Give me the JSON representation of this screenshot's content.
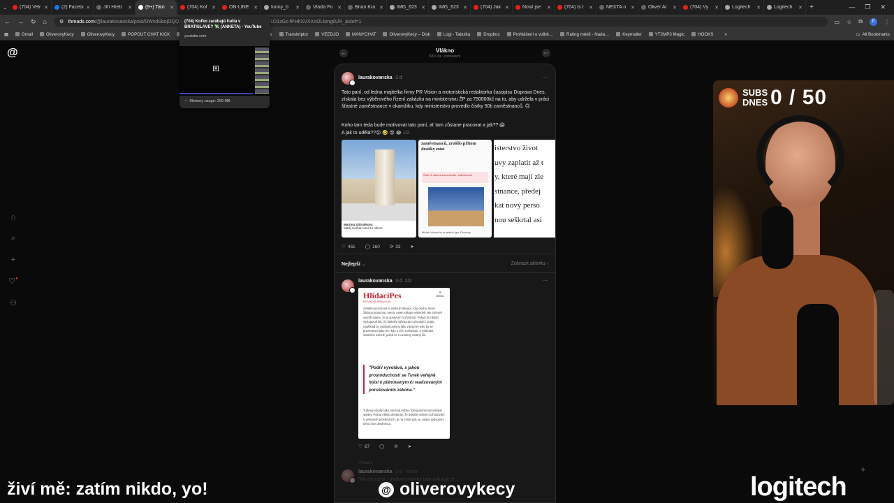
{
  "tabs": [
    {
      "label": "(704) Velr",
      "color": "#e62117"
    },
    {
      "label": "(2) Facebo",
      "color": "#1877f2"
    },
    {
      "label": "Jiří Hreb",
      "color": "#666"
    },
    {
      "label": "(9+) Tato",
      "color": "#fff",
      "active": true
    },
    {
      "label": "(704) Koľ",
      "color": "#e62117"
    },
    {
      "label": "ON-LINE",
      "color": "#e62117"
    },
    {
      "label": "funny_b",
      "color": "#aaa"
    },
    {
      "label": "Vláďa Fo",
      "color": "#666"
    },
    {
      "label": "Brian Kra",
      "color": "#666"
    },
    {
      "label": "IMG_623",
      "color": "#aaa"
    },
    {
      "label": "IMG_623",
      "color": "#aaa"
    },
    {
      "label": "(704) Jak",
      "color": "#e62117"
    },
    {
      "label": "Nosil jse",
      "color": "#e62117"
    },
    {
      "label": "(704) Is t",
      "color": "#e62117"
    },
    {
      "label": "NEXTA n",
      "color": "#666"
    },
    {
      "label": "Oliver Ar",
      "color": "#666"
    },
    {
      "label": "(704) Vy",
      "color": "#e62117"
    },
    {
      "label": "Logitech",
      "color": "#aaa"
    },
    {
      "label": "Logitech",
      "color": "#aaa"
    }
  ],
  "address": {
    "host": "threads.com",
    "path": "/@laurakovanska/post/DWvdSbojOQQ/?xmt=AQF0",
    "path_tail": "JAk7VtbP748jpvC3P1O1zGc-fPHhXVXXoOLtong6UR_&slof=1"
  },
  "bookmarks": [
    "Gmail",
    "OliverovyKecy",
    "OliverovyKecy",
    "POPOUT CHAT KICK",
    "TikTok",
    "ChatGPT",
    "StreamElements",
    "Transkriptor",
    "VEEDJO",
    "MANYCHAT",
    "OliverovyKecy – Disk",
    "Logi - Tabulka",
    "Dropbox",
    "Prohlášení o volbě…",
    "Rating médií - Nada…",
    "Keymailer",
    "YT2MP3 Magic",
    "HOOKS"
  ],
  "all_bookmarks": "All Bookmarks",
  "tooltip": {
    "title": "(704) Koľko zarábajú ľudia v BRATISLAVE? 💸 (ANKETA) - YouTube",
    "domain": "youtube.com",
    "memory": "Memory usage: 269 MB"
  },
  "feed_header": {
    "title": "Vlákno",
    "views": "58,6 tis. zobrazení"
  },
  "post1": {
    "username": "laurakovanska",
    "time": "3 d",
    "text1": "Tato paní, od ledna majitelka firmy PR Vision a motoristická redaktorka časopisu Doprava Dnes, získala bez výběrového řízení zakázku na ministerstvu ŽP za 750000kč na to, aby udržela v práci šťastné zaměstnance v okamžiku, kdy ministerstvo provedlo čistky 50ti zaměstnanců. 🙃",
    "text2": "Koho tam teda bude motivovat tato paní, ať tam zůstane pracovat a jak?? 😱",
    "text3": "A jak to udělá??😮 🤣 😵 😂",
    "page": "1/2",
    "img1_caption": "Martina Stibralková",
    "img1_likes": "Matěj Kerhart and 44 others",
    "img2_headline": "zaměstnanců, zrušilo přitom desítky míst",
    "img2_pink": "Čtěte 6 článek zaměstnání, zdůvodnění",
    "img2_caption": "Ministr životního prostředí Igor Červený",
    "img3_lines": [
      "isterstvo život",
      "uvy zaplatit až t",
      "y, které mají zle",
      "stnance, předej",
      "kat nový perso",
      "nou seškrtal asi"
    ],
    "likes": "461",
    "comments": "160",
    "reposts": "33"
  },
  "sort": {
    "label": "Nejlepší",
    "activity": "Zobrazit aktivitu"
  },
  "post2": {
    "username": "laurakovanska",
    "time": "3 d",
    "page": "2/2",
    "logo": "HlídacíPes",
    "logo_sub": "REDAKČNÍ ZPRAVODAJ",
    "menu": "MENU",
    "body": "Zvláštní pozornost si zaslouží situace, kdy osoba, která žádnou pravomoc nemá, nejen silitupe výsledek, ale zároveň vytváří dojem, že je správním rozhodnutí. Pokud by někdo vystupoval tak, že fakticky nahrazuje rozhodující orgán, například by vydával pokyny jako závazné nebo by se prezentoval jako ten, kdo o věci rozhoduje, a výsledek skutečně ovlivnil, jedná se o uvedený trestný čin.",
    "quote": "\"Podiv vyvolává, s jakou prostoduchostí se Turek veřejně hlásí k plánovaným či realizovaným porušováním zákona.\"",
    "body2": "Turkovy výroky také otevírají otázku transparentnosti veřejné správy. Pokud někdo deklaruje, že dokáže ovlivnit rozhodování o veřejných prostředcích, je na místě ptát se, jakým způsobem toho chce dosáhnout.",
    "likes": "67"
  },
  "post3": {
    "label": "Přidáno",
    "username": "laurakovanska",
    "time": "3 d",
    "tail": "Autor",
    "text": "Tak asi nenit i podworyvanjky tato doknuje je..."
  },
  "webcam": {
    "subs_label": "SUBS DNES",
    "subs_value": "0 / 50"
  },
  "overlay": {
    "status": "živí mě: zatím nikdo, yo!",
    "brand": "oliverovykecy",
    "logitech": "logitech"
  }
}
